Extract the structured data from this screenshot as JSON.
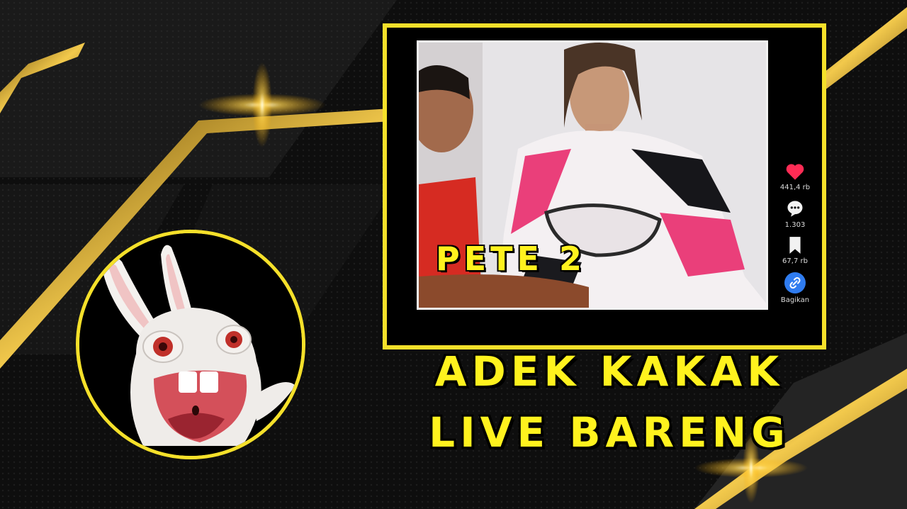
{
  "video": {
    "overlay_title": "PETE 2",
    "actions": {
      "likes": "441,4 rb",
      "comments": "1.303",
      "saves": "67,7 rb",
      "share_label": "Bagikan"
    }
  },
  "headline": {
    "line1": "ADEK KAKAK",
    "line2": "LIVE BARENG"
  },
  "colors": {
    "accent_yellow": "#f5e02a",
    "headline_yellow": "#fff21e",
    "gold": "#d4a21c",
    "like_red": "#ff2c55",
    "share_blue": "#2f7cf0"
  },
  "icons": [
    "heart-icon",
    "comment-icon",
    "bookmark-icon",
    "link-icon"
  ]
}
